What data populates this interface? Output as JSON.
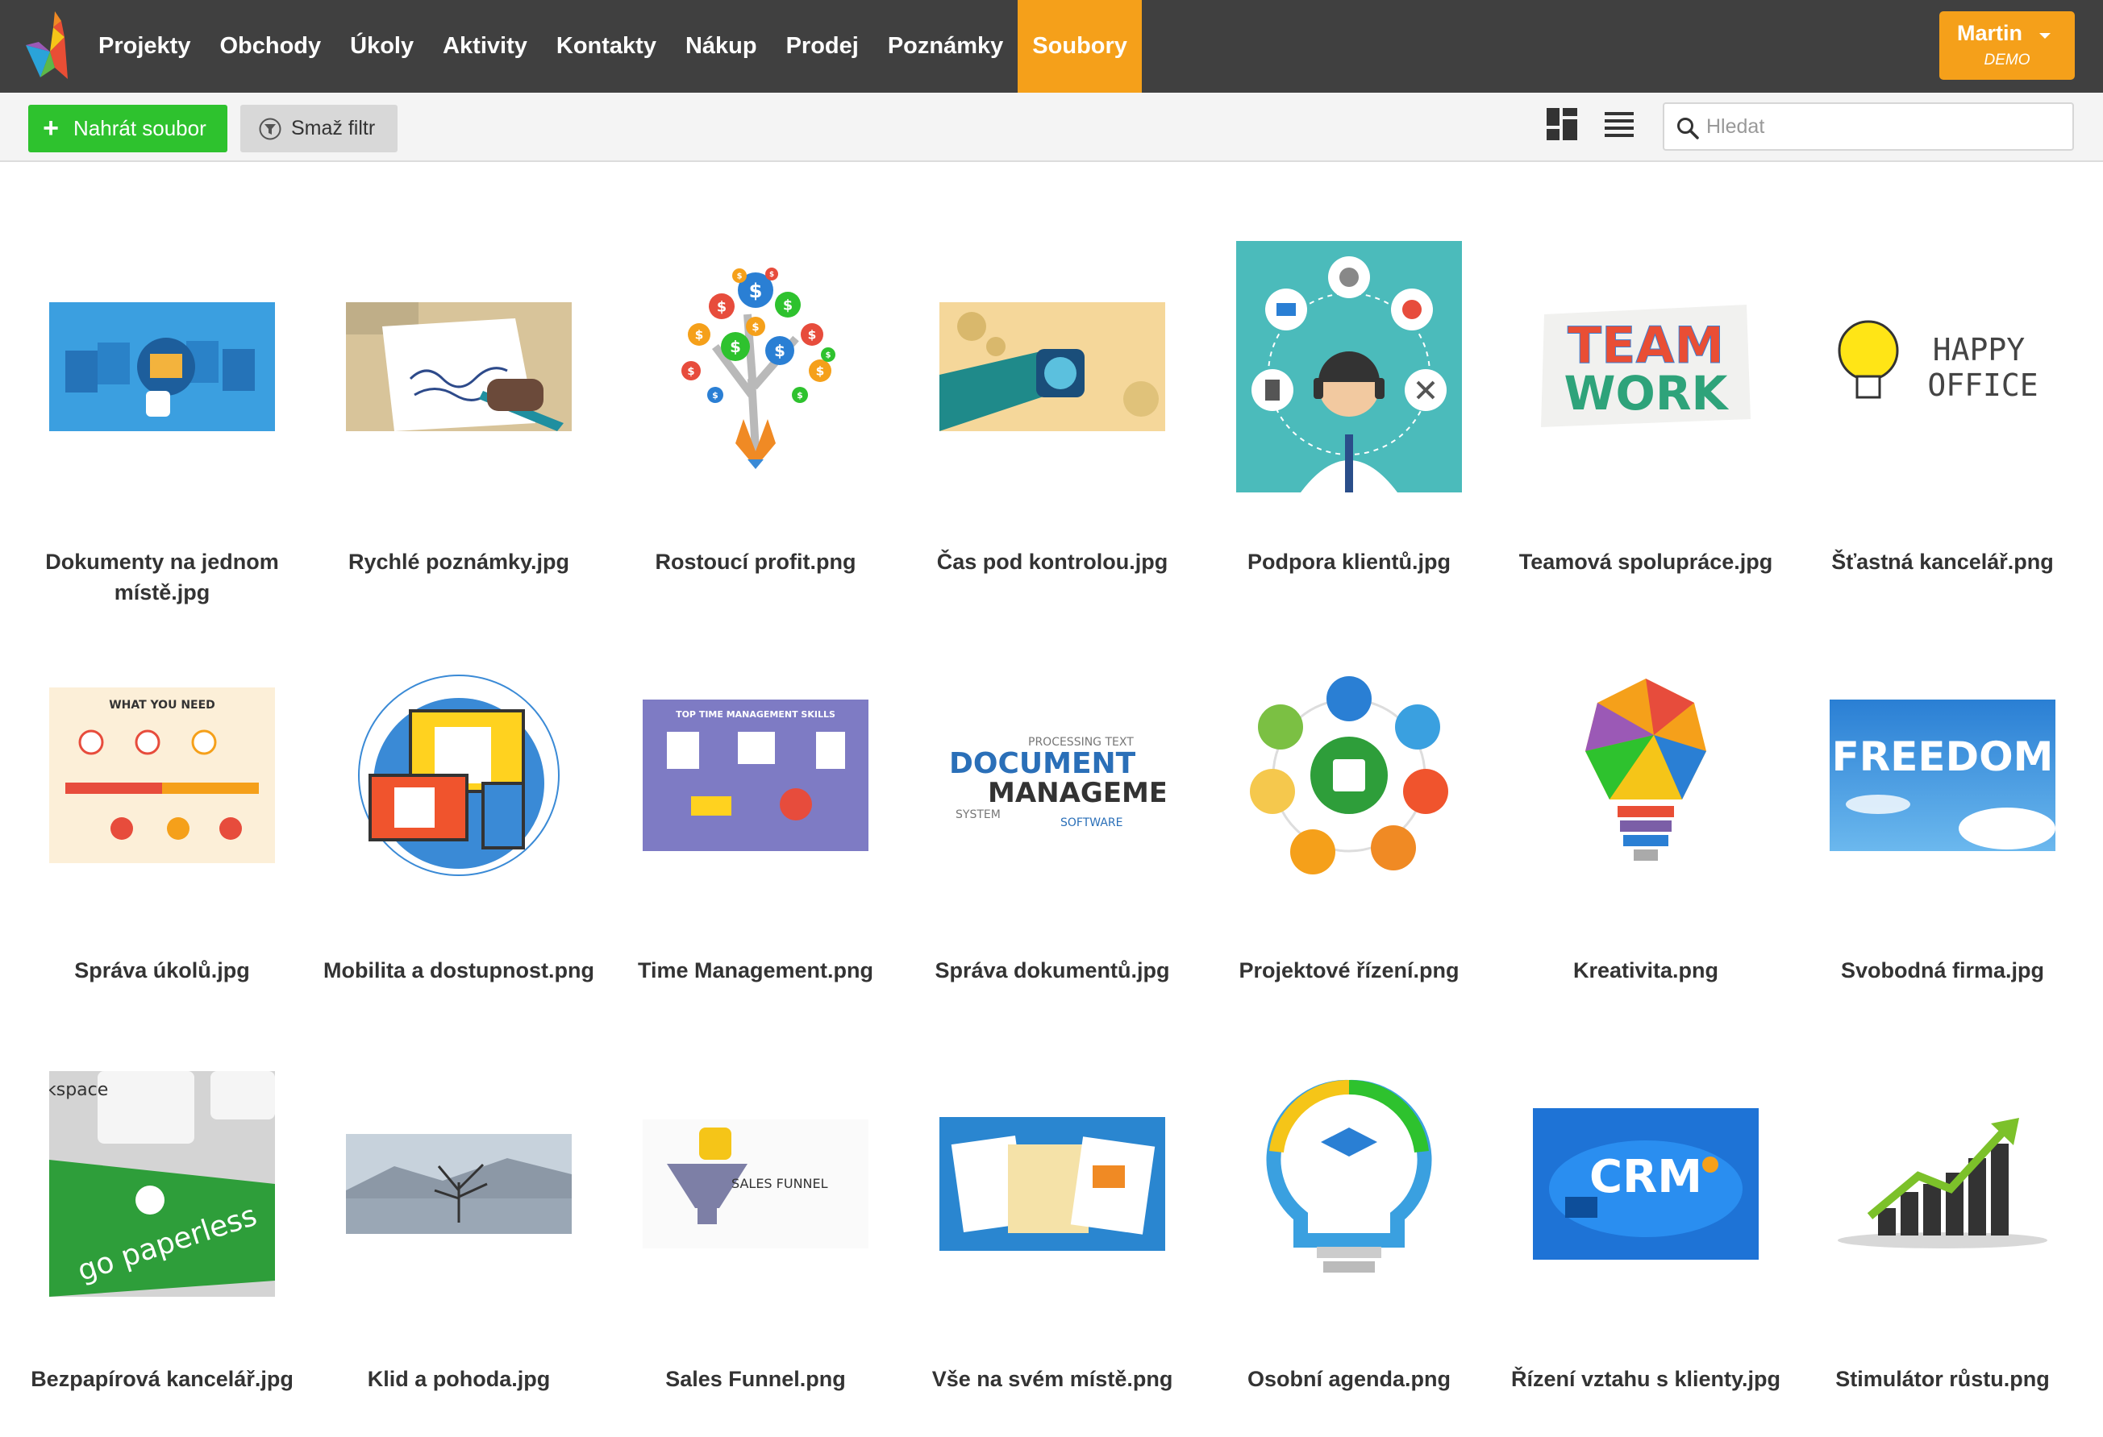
{
  "nav": {
    "items": [
      "Projekty",
      "Obchody",
      "Úkoly",
      "Aktivity",
      "Kontakty",
      "Nákup",
      "Prodej",
      "Poznámky",
      "Soubory"
    ],
    "active": "Soubory",
    "user_name": "Martin",
    "user_role": "DEMO"
  },
  "toolbar": {
    "upload_label": "Nahrát soubor",
    "clear_filter_label": "Smaž filtr",
    "search_placeholder": "Hledat",
    "search_value": ""
  },
  "colors": {
    "navbar": "#404040",
    "accent": "#f5a01a",
    "upload_button": "#2ec22e"
  },
  "files": [
    {
      "name": "Dokumenty na jednom místě.jpg",
      "thumbnail": "blue documents illustration"
    },
    {
      "name": "Rychlé poznámky.jpg",
      "thumbnail": "hand writing on notepad"
    },
    {
      "name": "Rostoucí profit.png",
      "thumbnail": "money tree with dollar coins"
    },
    {
      "name": "Čas pod kontrolou.jpg",
      "thumbnail": "wrist watch and gears"
    },
    {
      "name": "Podpora klientů.jpg",
      "thumbnail": "support agent with headset"
    },
    {
      "name": "Teamová spolupráce.jpg",
      "thumbnail": "TEAM WORK colorful text",
      "text": "TEAM WORK"
    },
    {
      "name": "Šťastná kancelář.png",
      "thumbnail": "light bulb with happy office text",
      "text": "HAPPY OFFICE"
    },
    {
      "name": "Správa úkolů.jpg",
      "thumbnail": "task management infographic",
      "text": "WHAT YOU NEED"
    },
    {
      "name": "Mobilita a dostupnost.png",
      "thumbnail": "devices illustration"
    },
    {
      "name": "Time Management.png",
      "thumbnail": "time management skills infographic",
      "text": "TOP TIME MANAGEMENT SKILLS"
    },
    {
      "name": "Správa dokumentů.jpg",
      "thumbnail": "document management word cloud",
      "text": "DOCUMENT MANAGEMENT"
    },
    {
      "name": "Projektové řízení.png",
      "thumbnail": "project management icons circle"
    },
    {
      "name": "Kreativita.png",
      "thumbnail": "colorful polygon light bulb"
    },
    {
      "name": "Svobodná firma.jpg",
      "thumbnail": "FREEDOM clouds in sky",
      "text": "FREEDOM"
    },
    {
      "name": "Bezpapírová kancelář.jpg",
      "thumbnail": "green go paperless key",
      "text": "go paperless"
    },
    {
      "name": "Klid a pohoda.jpg",
      "thumbnail": "tree in lake landscape"
    },
    {
      "name": "Sales Funnel.png",
      "thumbnail": "sales funnel illustration",
      "text": "SALES FUNNEL"
    },
    {
      "name": "Vše na svém místě.png",
      "thumbnail": "folders and documents"
    },
    {
      "name": "Osobní agenda.png",
      "thumbnail": "light bulb with icons"
    },
    {
      "name": "Řízení vztahu s klienty.jpg",
      "thumbnail": "CRM isometric illustration",
      "text": "CRM"
    },
    {
      "name": "Stimulátor růstu.png",
      "thumbnail": "growth bar chart with arrow"
    }
  ]
}
